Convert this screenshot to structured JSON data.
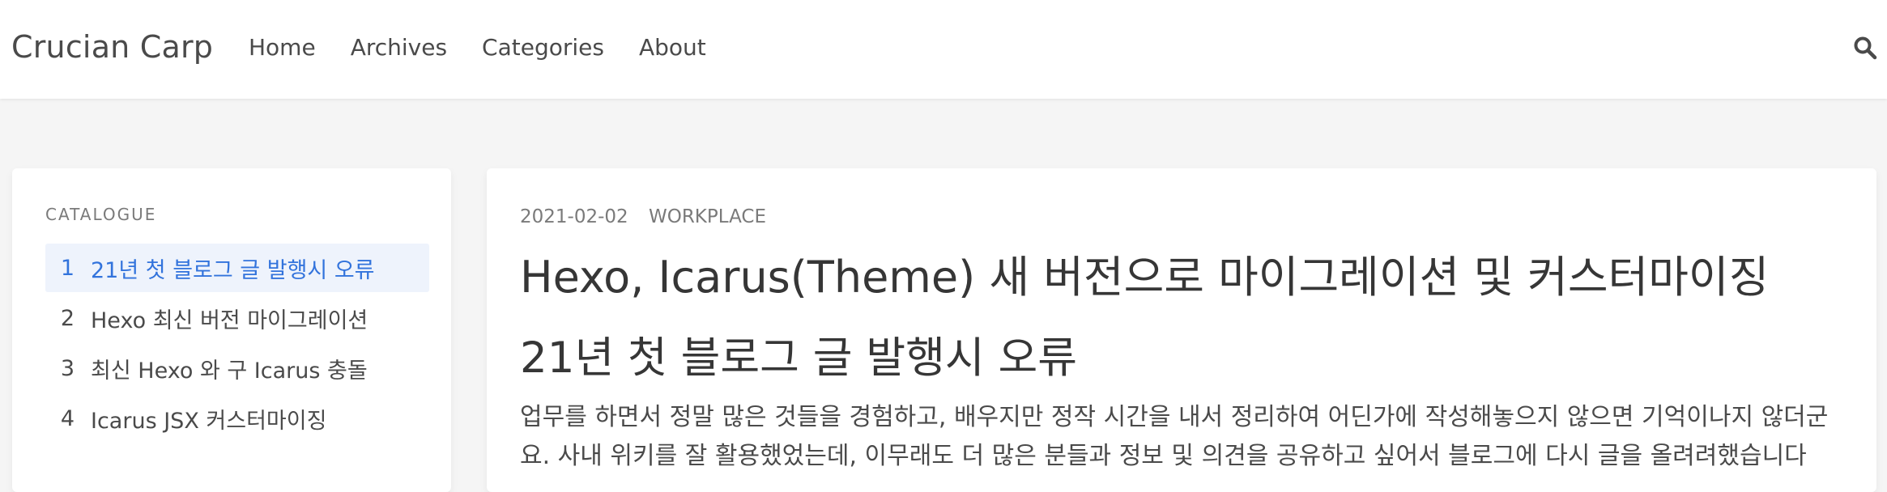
{
  "navbar": {
    "brand": "Crucian Carp",
    "links": [
      "Home",
      "Archives",
      "Categories",
      "About"
    ],
    "search_icon": "search-icon"
  },
  "toc": {
    "heading": "CATALOGUE",
    "items": [
      {
        "num": "1",
        "label": "21년 첫 블로그 글 발행시 오류",
        "active": true
      },
      {
        "num": "2",
        "label": "Hexo 최신 버전 마이그레이션"
      },
      {
        "num": "3",
        "label": "최신 Hexo 와 구 Icarus 충돌"
      },
      {
        "num": "4",
        "label": "Icarus JSX 커스터마이징"
      }
    ]
  },
  "post": {
    "date": "2021-02-02",
    "category": "WORKPLACE",
    "title": "Hexo, Icarus(Theme) 새 버전으로 마이그레이션 및 커스터마이징",
    "h2": "21년 첫 블로그 글 발행시 오류",
    "body": "업무를 하면서 정말 많은 것들을 경험하고, 배우지만 정작 시간을 내서 정리하여 어딘가에 작성해놓으지 않으면 기억이나지 않더군요. 사내 위키를 잘 활용했었는데, 이무래도 더 많은 분들과 정보 및 의견을 공유하고 싶어서 블로그에 다시 글을 올려려했습니다"
  },
  "colors": {
    "accent": "#3273dc",
    "active_bg": "#eef3fc",
    "page_bg": "#f5f5f5"
  }
}
